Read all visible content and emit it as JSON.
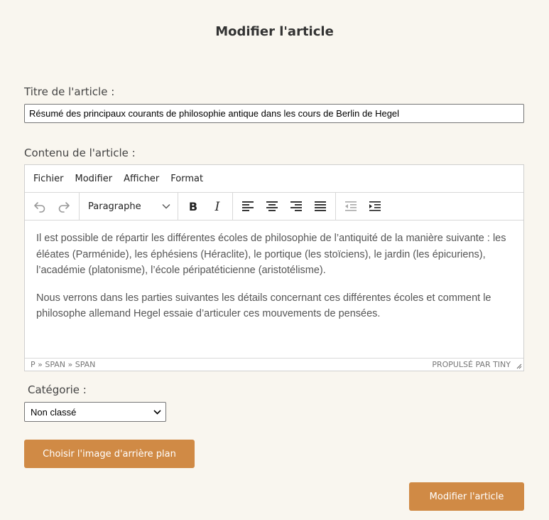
{
  "page": {
    "title": "Modifier l'article"
  },
  "title_field": {
    "label": "Titre de l'article :",
    "value": "Résumé des principaux courants de philosophie antique dans les cours de Berlin de Hegel"
  },
  "content_field": {
    "label": "Contenu de l'article :"
  },
  "editor": {
    "menu": [
      "Fichier",
      "Modifier",
      "Afficher",
      "Format"
    ],
    "block_format": "Paragraphe",
    "paragraphs": [
      "Il est possible de répartir les différentes écoles de philosophie de l’antiquité de la manière suivante : les éléates (Parménide), les éphésiens (Héraclite), le portique (les stoïciens), le jardin (les épicuriens), l’académie (platonisme), l’école péripatéticienne (aristotélisme).",
      "Nous verrons dans les parties suivantes les détails concernant ces différentes écoles et comment le philosophe allemand Hegel essaie d’articuler ces mouvements de pensées."
    ],
    "path": "P » SPAN » SPAN",
    "brand": "PROPULSÉ PAR TINY"
  },
  "category": {
    "label": "Catégorie :",
    "selected": "Non classé"
  },
  "buttons": {
    "choose_image": "Choisir l'image d'arrière plan",
    "submit": "Modifier l'article"
  },
  "colors": {
    "accent": "#d08a45",
    "background": "#f9f6ef"
  }
}
